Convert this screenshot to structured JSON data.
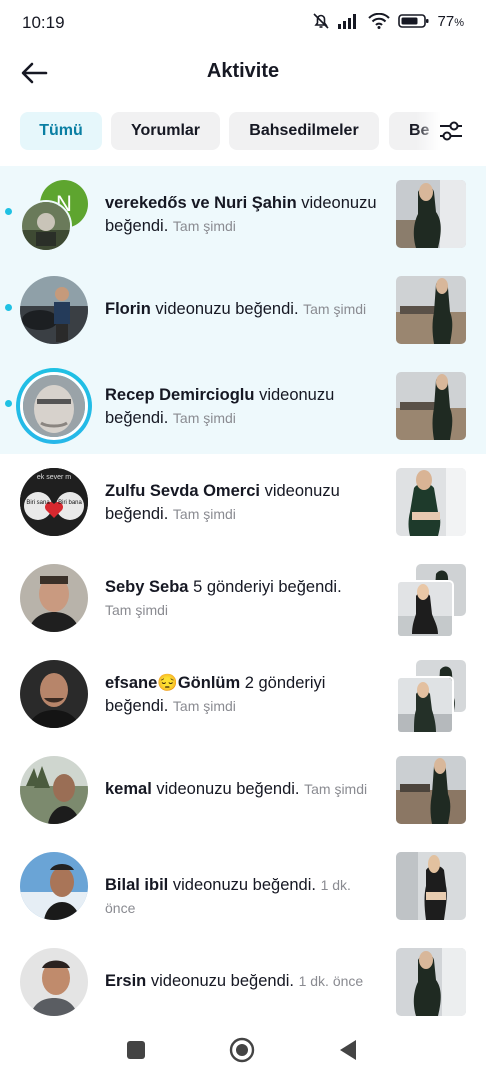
{
  "status": {
    "time": "10:19",
    "battery": "77",
    "battery_unit": "%"
  },
  "header": {
    "title": "Aktivite"
  },
  "tabs": [
    "Tümü",
    "Yorumlar",
    "Bahsedilmeler",
    "Be"
  ],
  "activities": [
    {
      "name": "verekedős ve Nuri Şahin",
      "action": "videonuzu beğendi.",
      "time": "Tam şimdi",
      "initial": "N",
      "unread": true
    },
    {
      "name": "Florin",
      "action": "videonuzu beğendi.",
      "time": "Tam şimdi",
      "unread": true
    },
    {
      "name": "Recep Demircioglu",
      "action": "videonuzu beğendi.",
      "time": "Tam şimdi",
      "unread": true
    },
    {
      "name": "Zulfu Sevda Omerci",
      "action": "videonuzu beğendi.",
      "time": "Tam şimdi",
      "unread": false
    },
    {
      "name": "Seby Seba",
      "action": "5 gönderiyi beğendi.",
      "time": "Tam şimdi",
      "unread": false
    },
    {
      "name": "efsane😔Gönlüm",
      "action": "2 gönderiyi beğendi.",
      "time": "Tam şimdi",
      "unread": false
    },
    {
      "name": "kemal",
      "action": "videonuzu beğendi.",
      "time": "Tam şimdi",
      "unread": false
    },
    {
      "name": "Bilal ibil",
      "action": "videonuzu beğendi.",
      "time": "1 dk. önce",
      "unread": false
    },
    {
      "name": "Ersin",
      "action": "videonuzu beğendi.",
      "time": "1 dk. önce",
      "unread": false
    }
  ],
  "avatar_badge": {
    "top": "ek sever m",
    "left": "Biri sana",
    "right": "Biri bana"
  },
  "colors": {
    "accent": "#1fc1e3",
    "unread_bg": "#eef9fc",
    "active_tab_bg": "#e6f7fb"
  }
}
